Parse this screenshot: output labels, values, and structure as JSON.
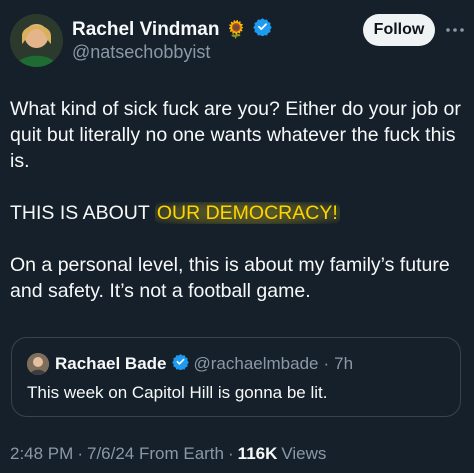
{
  "author": {
    "name": "Rachel Vindman",
    "emoji": "🌻",
    "handle": "@natsechobbyist",
    "verified_color": "#1d9bf0"
  },
  "follow_label": "Follow",
  "tweet": {
    "line1": "What kind of sick fuck are you? Either do your job or quit but literally no one wants whatever the fuck this is.",
    "line2_prefix": "THIS IS ABOUT ",
    "line2_highlight": "OUR DEMOCRACY!",
    "line3": "On a personal level, this is about my family’s future and safety. It’s not a football game."
  },
  "quote": {
    "name": "Rachael Bade",
    "handle": "@rachaelmbade",
    "separator": "·",
    "time": "7h",
    "text": "This week on Capitol Hill is gonna be lit."
  },
  "footer": {
    "time": "2:48 PM",
    "sep1": "·",
    "date": "7/6/24 From Earth",
    "sep2": "·",
    "views_count": "116K",
    "views_label": "Views"
  },
  "icons": {
    "verified": "verified-badge-icon",
    "more": "more-dots-icon"
  },
  "colors": {
    "background": "#15202b",
    "text": "#f7f9f9",
    "muted": "#8b98a5",
    "highlight": "#ffd400",
    "border": "#38444d"
  }
}
